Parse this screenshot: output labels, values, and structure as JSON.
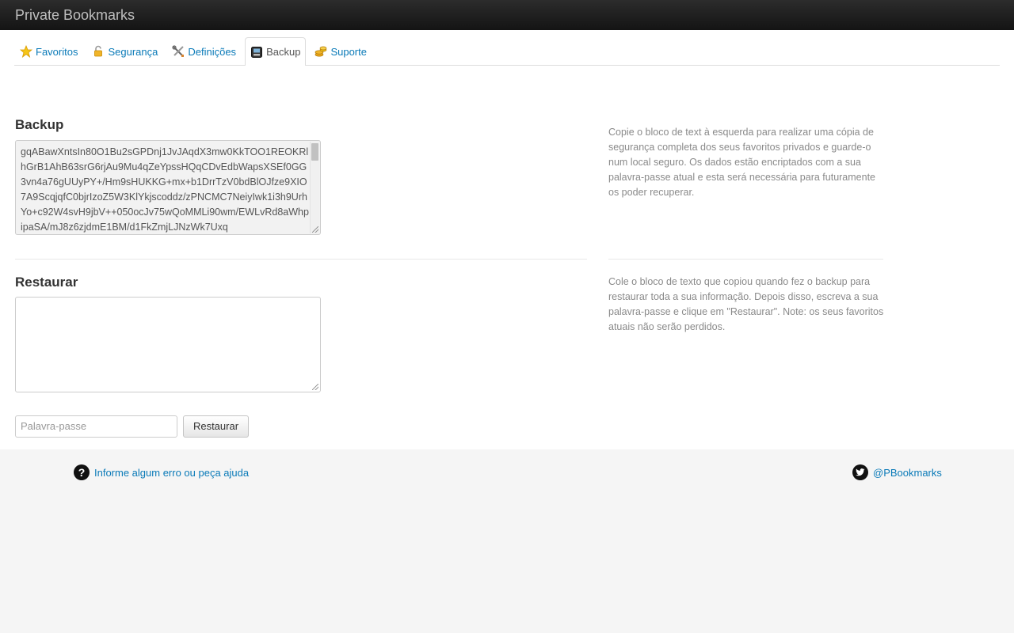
{
  "app": {
    "title": "Private Bookmarks"
  },
  "tabs": [
    {
      "label": "Favoritos",
      "icon": "star-icon"
    },
    {
      "label": "Segurança",
      "icon": "lock-icon"
    },
    {
      "label": "Definições",
      "icon": "tools-icon"
    },
    {
      "label": "Backup",
      "icon": "backup-icon",
      "active": true
    },
    {
      "label": "Suporte",
      "icon": "coins-icon"
    }
  ],
  "backup": {
    "title": "Backup",
    "data": "gqABawXntsIn80O1Bu2sGPDnj1JvJAqdX3mw0KkTOO1REOKRlhGrB1AhB63srG6rjAu9Mu4qZeYpssHQqCDvEdbWapsXSEf0GG3vn4a76gUUyPY+/Hm9sHUKKG+mx+b1DrrTzV0bdBlOJfze9XIO7A9ScqjqfC0bjrIzoZ5W3KlYkjscoddz/zPNCMC7NeiyIwk1i3h9UrhYo+c92W4svH9jbV++050ocJv75wQoMMLi90wm/EWLvRd8aWhpipaSA/mJ8z6zjdmE1BM/d1FkZmjLJNzWk7Uxq",
    "help": "Copie o bloco de text à esquerda para realizar uma cópia de segurança completa dos seus favoritos privados e guarde-o num local seguro. Os dados estão encriptados com a sua palavra-passe atual e esta será necessária para futuramente os poder recuperar."
  },
  "restore": {
    "title": "Restaurar",
    "textarea_value": "",
    "password_placeholder": "Palavra-passe",
    "button_label": "Restaurar",
    "help": "Cole o bloco de texto que copiou quando fez o backup para restaurar toda a sua informação. Depois disso, escreva a sua palavra-passe e clique em \"Restaurar\". Note: os seus favoritos atuais não serão perdidos."
  },
  "footer": {
    "help_link": "Informe algum erro ou peça ajuda",
    "twitter_handle": "@PBookmarks"
  }
}
